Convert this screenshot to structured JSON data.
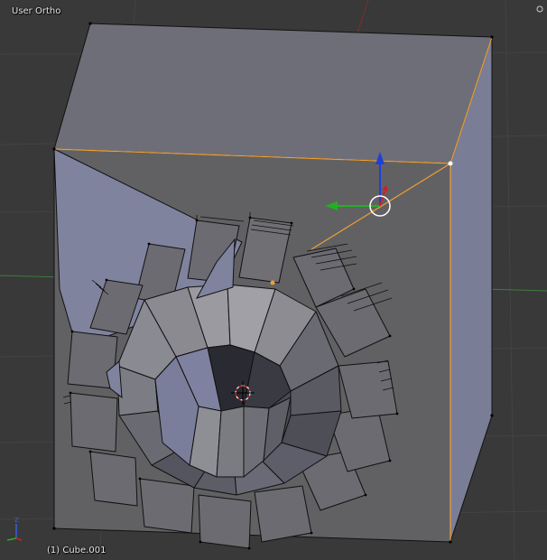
{
  "viewport": {
    "view_name": "User Ortho",
    "object_name": "(1) Cube.001",
    "colors": {
      "background": "#393939",
      "grid": "#434343",
      "mesh_side": "#7a7d96",
      "mesh_top": "#6e6e78",
      "mesh_front": "#616164",
      "selected_edge": "#f0a030",
      "x_axis": "#b44b4b",
      "y_axis": "#4fa04f",
      "gizmo_z": "#1f3fd8",
      "gizmo_y": "#22b022",
      "gizmo_x": "#d02020"
    },
    "icons": [
      "transform-gizmo",
      "3d-cursor",
      "axis-orientation-icon",
      "pivot-point-icon"
    ]
  }
}
